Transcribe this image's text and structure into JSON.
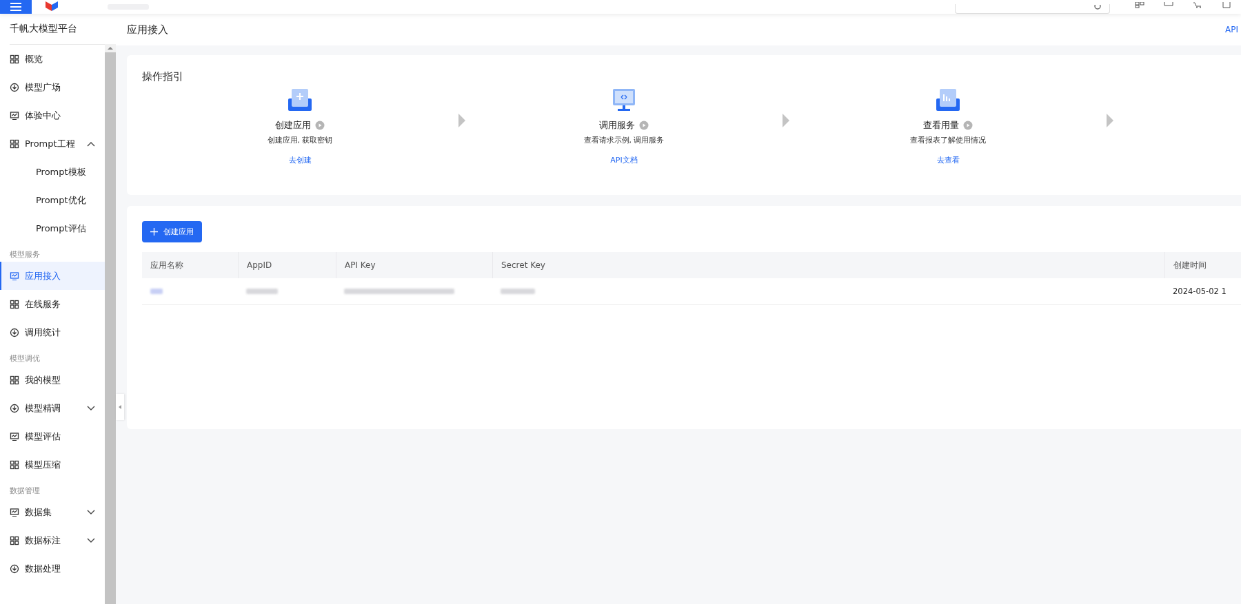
{
  "sidebar": {
    "title": "千帆大模型平台",
    "items": [
      {
        "kind": "item",
        "label": "概览",
        "selected": false
      },
      {
        "kind": "item",
        "label": "模型广场",
        "selected": false
      },
      {
        "kind": "item",
        "label": "体验中心",
        "selected": false
      },
      {
        "kind": "item",
        "label": "Prompt工程",
        "selected": false,
        "expanded": true,
        "children": [
          {
            "kind": "sub",
            "label": "Prompt模板",
            "selected": false
          },
          {
            "kind": "sub",
            "label": "Prompt优化",
            "selected": false
          },
          {
            "kind": "sub",
            "label": "Prompt评估",
            "selected": false
          }
        ]
      },
      {
        "kind": "group",
        "label": "模型服务"
      },
      {
        "kind": "item",
        "label": "应用接入",
        "selected": true
      },
      {
        "kind": "item",
        "label": "在线服务",
        "selected": false
      },
      {
        "kind": "item",
        "label": "调用统计",
        "selected": false
      },
      {
        "kind": "group",
        "label": "模型调优"
      },
      {
        "kind": "item",
        "label": "我的模型",
        "selected": false
      },
      {
        "kind": "item",
        "label": "模型精调",
        "selected": false,
        "expanded": false
      },
      {
        "kind": "item",
        "label": "模型评估",
        "selected": false
      },
      {
        "kind": "item",
        "label": "模型压缩",
        "selected": false
      },
      {
        "kind": "group",
        "label": "数据管理"
      },
      {
        "kind": "item",
        "label": "数据集",
        "selected": false,
        "expanded": false
      },
      {
        "kind": "item",
        "label": "数据标注",
        "selected": false,
        "expanded": false
      },
      {
        "kind": "item",
        "label": "数据处理",
        "selected": false
      }
    ]
  },
  "page": {
    "title": "应用接入",
    "top_link": "API"
  },
  "guide": {
    "title": "操作指引",
    "steps": [
      {
        "title": "创建应用",
        "description": "创建应用, 获取密钥",
        "link": "去创建"
      },
      {
        "title": "调用服务",
        "description": "查看请求示例, 调用服务",
        "link": "API文档"
      },
      {
        "title": "查看用量",
        "description": "查看报表了解使用情况",
        "link": "去查看"
      }
    ]
  },
  "create_button": "创建应用",
  "table": {
    "columns": [
      "应用名称",
      "AppID",
      "API Key",
      "Secret Key",
      "创建时间"
    ],
    "rows": [
      {
        "cells": [
          {
            "kind": "redacted"
          },
          {
            "kind": "redacted"
          },
          {
            "kind": "redacted"
          },
          {
            "kind": "redacted"
          },
          {
            "kind": "text",
            "text": "2024-05-02 1"
          }
        ]
      }
    ]
  }
}
